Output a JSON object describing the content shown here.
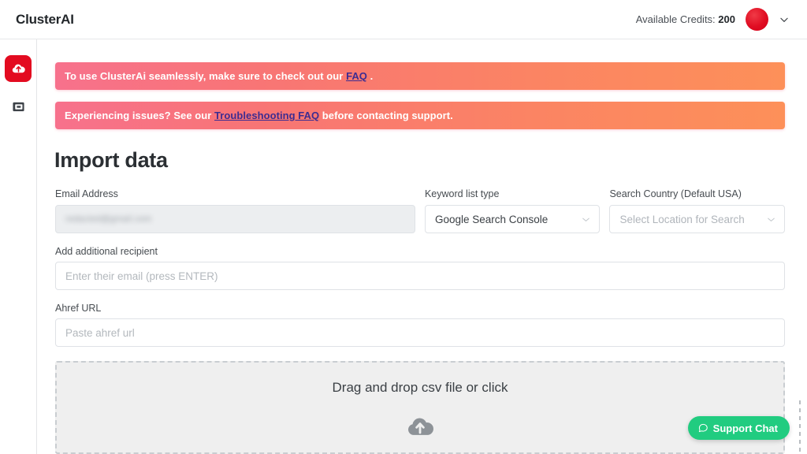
{
  "header": {
    "brand": "ClusterAI",
    "credits_label": "Available Credits:",
    "credits_value": "200",
    "avatar_icon": "avatar-circle",
    "chevron_icon": "chevron-down-icon",
    "accent_red": "#e30b20"
  },
  "sidebar": {
    "items": [
      {
        "icon": "cloud-upload-icon",
        "active": true
      },
      {
        "icon": "collection-card-icon",
        "active": false
      }
    ]
  },
  "banners": [
    {
      "before": "To use ClusterAi seamlessly, make sure to check out our ",
      "link": "FAQ",
      "after": " ."
    },
    {
      "before": "Experiencing issues? See our ",
      "link": "Troubleshooting FAQ",
      "after": " before contacting support."
    }
  ],
  "main": {
    "title": "Import data",
    "email": {
      "label": "Email Address",
      "value": "redacted@gmail.com",
      "readonly": true
    },
    "keyword_list_type": {
      "label": "Keyword list type",
      "selected": "Google Search Console",
      "caret_icon": "chevron-down-icon"
    },
    "search_country": {
      "label": "Search Country (Default USA)",
      "placeholder": "Select Location for Search",
      "selected": "",
      "caret_icon": "chevron-down-icon"
    },
    "additional_recipient": {
      "label": "Add additional recipient",
      "placeholder": "Enter their email (press ENTER)",
      "value": ""
    },
    "ahref_url": {
      "label": "Ahref URL",
      "placeholder": "Paste ahref url",
      "value": ""
    },
    "dropzone": {
      "text": "Drag and drop csv file or click",
      "icon": "cloud-upload-icon"
    }
  },
  "support_chat": {
    "label": "Support Chat",
    "icon": "chat-bubble-icon",
    "color": "#21cc80"
  },
  "colors": {
    "banner_gradient_start": "#f7718c",
    "banner_gradient_end": "#fd9059",
    "banner_link": "#3d2c91",
    "sidebar_active": "#e30b20",
    "dropzone_bg": "#efefef"
  }
}
